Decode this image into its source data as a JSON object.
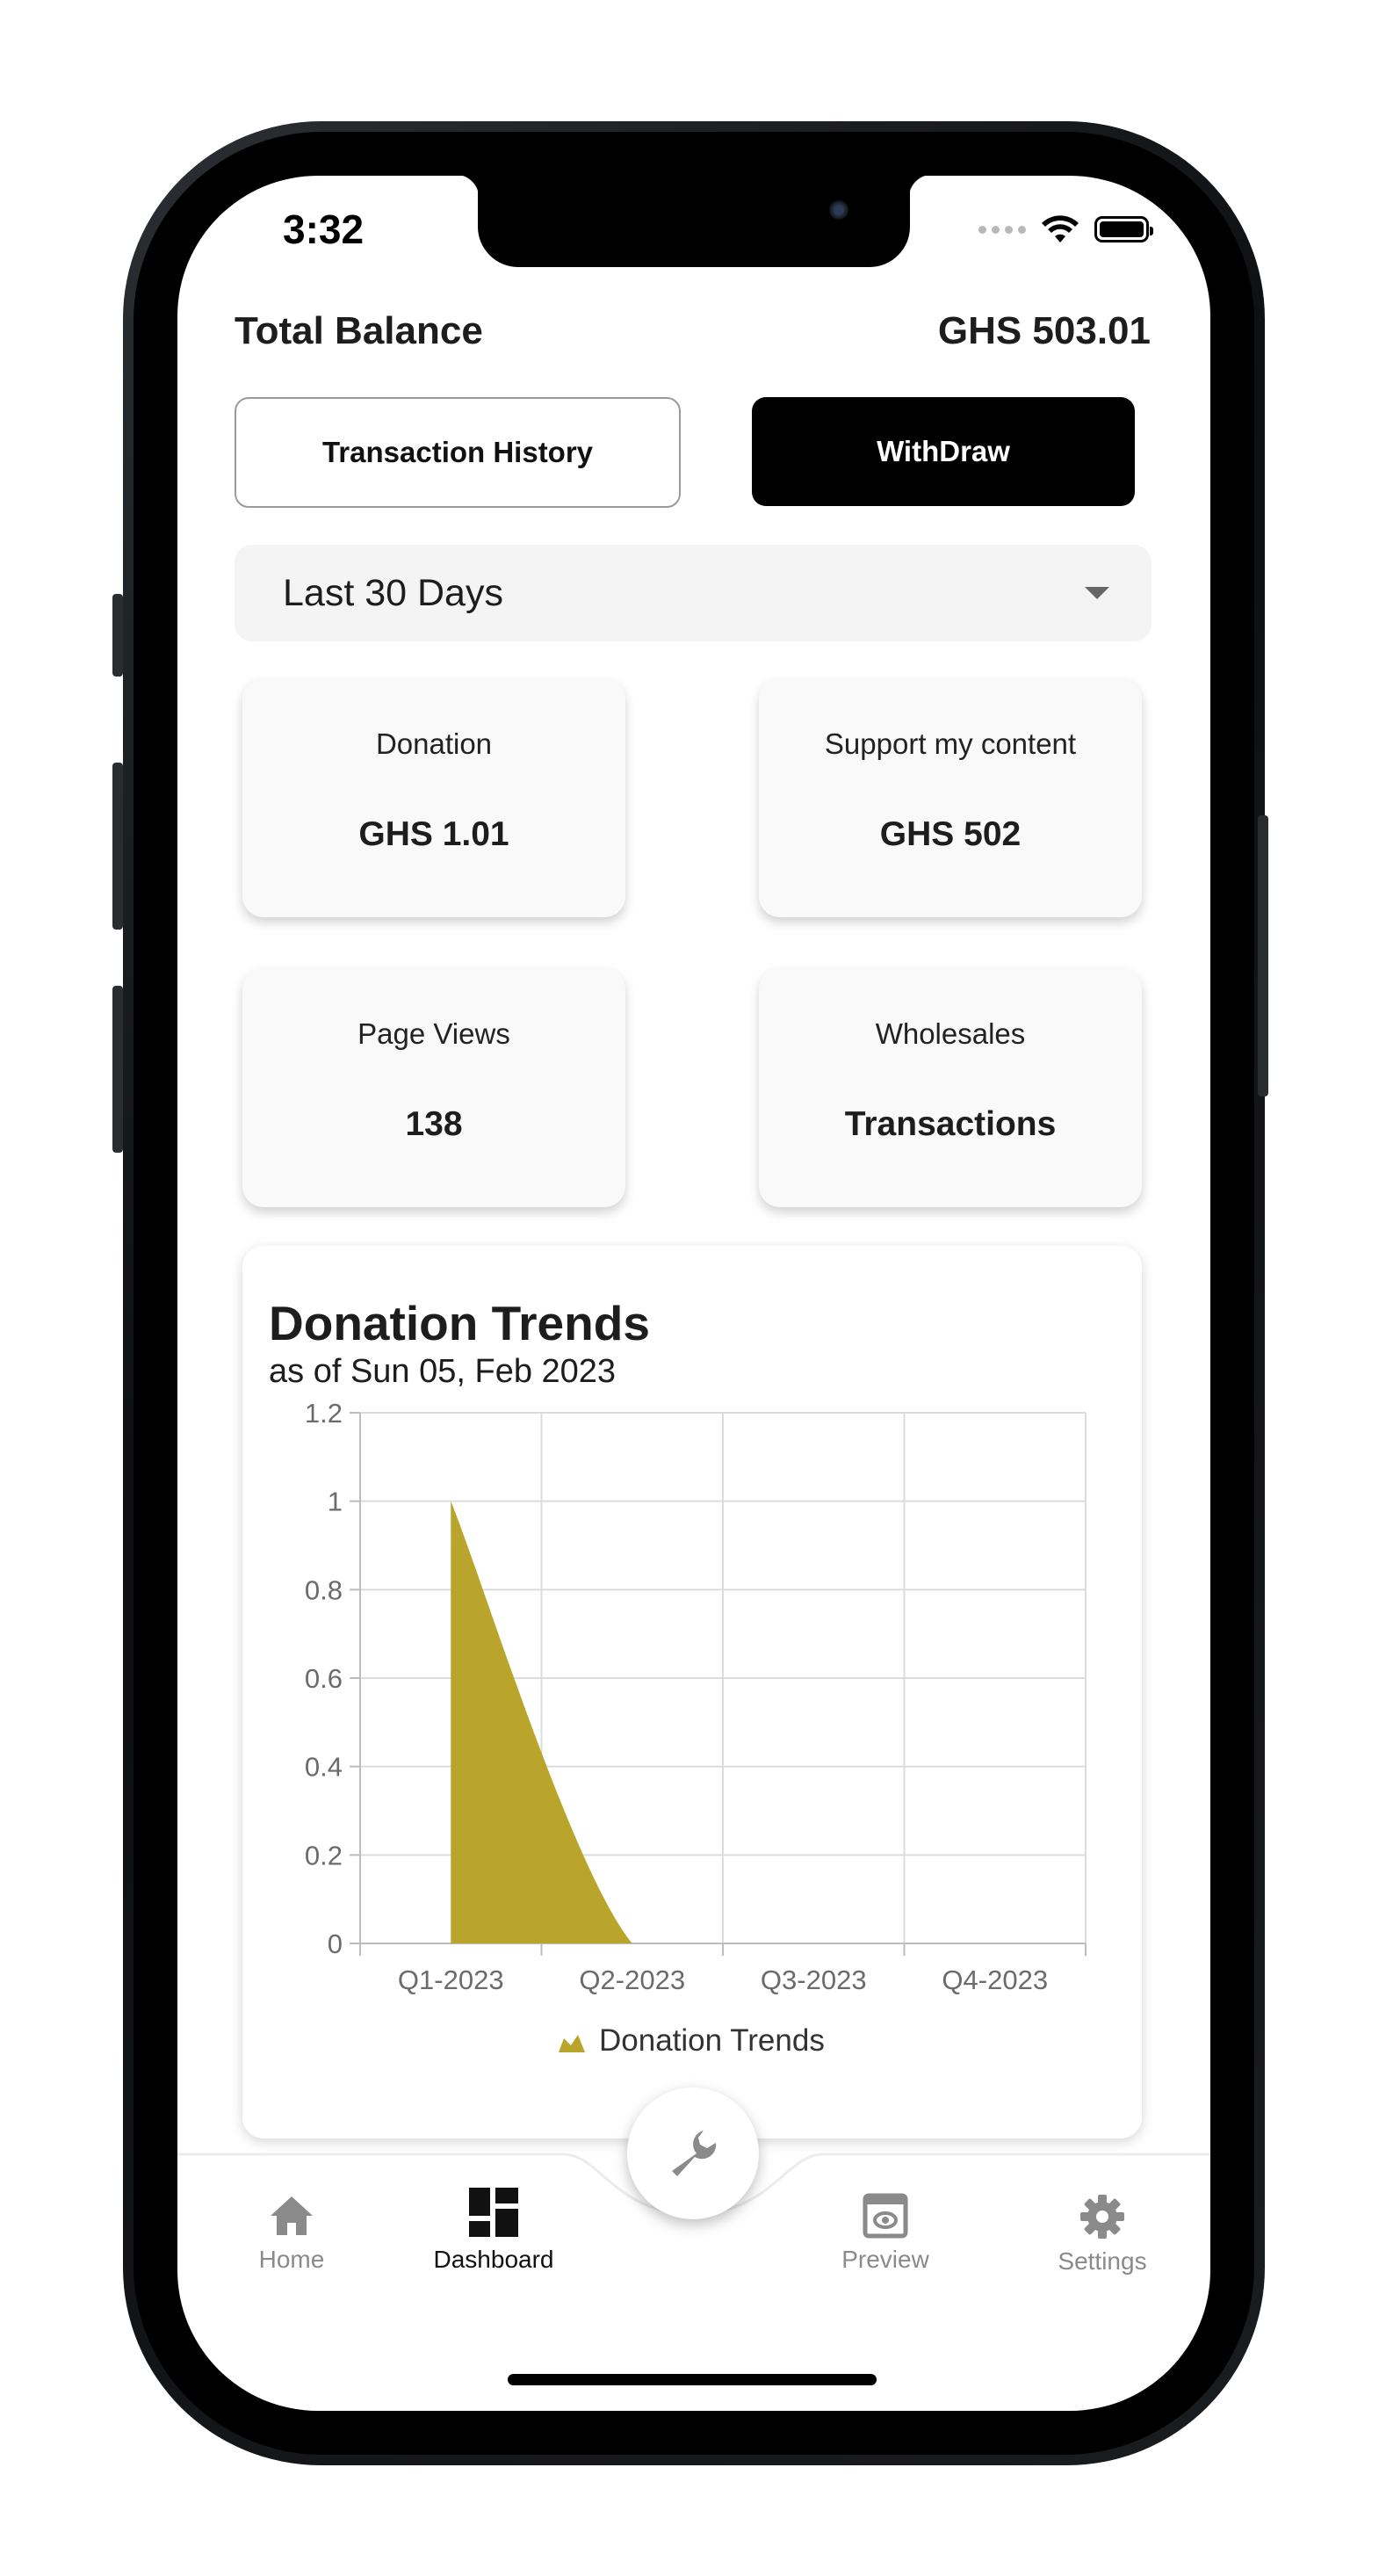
{
  "status_bar": {
    "time": "3:32"
  },
  "balance": {
    "label": "Total Balance",
    "value": "GHS 503.01"
  },
  "buttons": {
    "history": "Transaction History",
    "withdraw": "WithDraw"
  },
  "period_select": {
    "value": "Last 30 Days"
  },
  "stat_cards": [
    {
      "title": "Donation",
      "value": "GHS 1.01"
    },
    {
      "title": "Support my content",
      "value": "GHS 502"
    },
    {
      "title": "Page Views",
      "value": "138"
    },
    {
      "title": "Wholesales",
      "value": "Transactions"
    }
  ],
  "chart_card": {
    "title": "Donation Trends",
    "subtitle": "as of Sun 05, Feb 2023"
  },
  "chart_data": {
    "type": "area",
    "title": "Donation Trends",
    "categories": [
      "Q1-2023",
      "Q2-2023",
      "Q3-2023",
      "Q4-2023"
    ],
    "y_ticks": [
      "0",
      "0.2",
      "0.4",
      "0.6",
      "0.8",
      "1",
      "1.2"
    ],
    "ylim": [
      0,
      1.2
    ],
    "grid": true,
    "legend": "bottom-center",
    "series": [
      {
        "name": "Donation Trends",
        "values": [
          1,
          0,
          0,
          0
        ],
        "color": "#b9a52b"
      }
    ]
  },
  "tabbar": {
    "home": "Home",
    "dashboard": "Dashboard",
    "preview": "Preview",
    "settings": "Settings",
    "center_icon": "wrench-icon"
  }
}
